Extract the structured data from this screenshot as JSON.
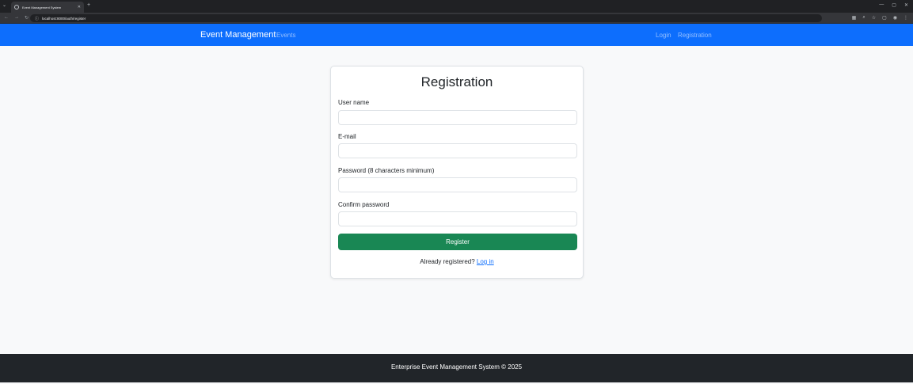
{
  "browser": {
    "tab_title": "Event Management System",
    "url": "localhost:8000/auth/register"
  },
  "navbar": {
    "brand": "Event Management",
    "events": "Events",
    "login": "Login",
    "registration": "Registration",
    "color": "#0d6efd"
  },
  "form": {
    "title": "Registration",
    "username_label": "User name",
    "email_label": "E-mail",
    "password_label": "Password (8 characters minimum)",
    "confirm_label": "Confirm password",
    "username_value": "",
    "email_value": "",
    "password_value": "",
    "confirm_value": "",
    "submit_label": "Register",
    "submit_color": "#198754",
    "already_text": "Already registered?",
    "login_link": "Log in"
  },
  "footer": {
    "text": "Enterprise Event Management System © 2025"
  }
}
